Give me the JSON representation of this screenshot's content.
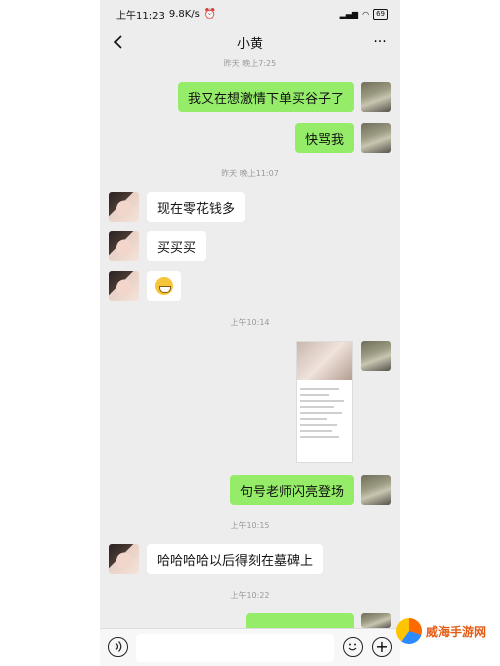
{
  "status": {
    "time": "上午11:23",
    "speed": "9.8K/s",
    "battery": "69"
  },
  "chat": {
    "title": "小黄"
  },
  "messages": {
    "t1": "昨天 晚上7:25",
    "m1": "我又在想激情下单买谷子了",
    "m2": "快骂我",
    "t2": "昨天 晚上11:07",
    "m3": "现在零花钱多",
    "m4": "买买买",
    "t3": "上午10:14",
    "m5": "句号老师闪亮登场",
    "t4": "上午10:15",
    "m6": "哈哈哈哈以后得刻在墓碑上",
    "t5": "上午10:22"
  },
  "watermark": {
    "text": "威海手游网"
  },
  "colors": {
    "outgoing_bubble": "#95ec69",
    "incoming_bubble": "#ffffff",
    "chat_background": "#ededed"
  }
}
